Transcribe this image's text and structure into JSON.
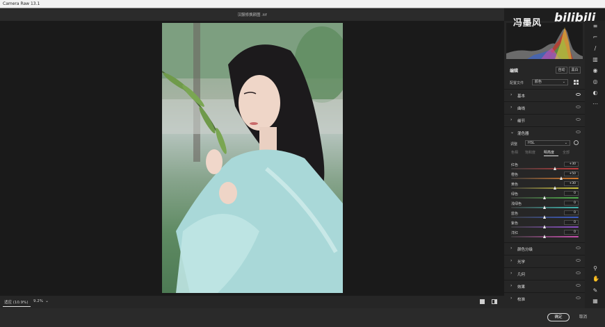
{
  "window": {
    "title": "Camera Raw 13.1"
  },
  "document": {
    "filename": "汉服修换颜图 .tif"
  },
  "watermark": {
    "text": "冯墨风",
    "logo": "bilibili"
  },
  "bottom_bar": {
    "zoom_label": "适应 (10.9%)",
    "zoom_percent": "9.2%"
  },
  "footer": {
    "ok_label": "确定",
    "cancel_label": "取消"
  },
  "panel": {
    "edit_title": "编辑",
    "auto_label": "自动",
    "bw_label": "黑白",
    "profile_label": "配置文件",
    "profile_value": "颜色",
    "sections_top": [
      {
        "label": "基本",
        "eye": "on"
      },
      {
        "label": "曲线",
        "eye": "off"
      },
      {
        "label": "细节",
        "eye": "off"
      }
    ],
    "mixer": {
      "title": "混色器",
      "adjust_label": "调整",
      "adjust_value": "HSL",
      "tabs": [
        "色相",
        "饱和度",
        "明亮度",
        "全部"
      ],
      "active_tab": "明亮度",
      "sliders": [
        {
          "name": "红色",
          "value": "+30",
          "level": 0.65,
          "track": "linear-gradient(90deg,#3a3a3a,#c23b3b)"
        },
        {
          "name": "橙色",
          "value": "+50",
          "level": 0.75,
          "track": "linear-gradient(90deg,#3a3a3a,#d77a2c)"
        },
        {
          "name": "黄色",
          "value": "+30",
          "level": 0.65,
          "track": "linear-gradient(90deg,#3a3a3a,#cfc43a)"
        },
        {
          "name": "绿色",
          "value": "0",
          "level": 0.5,
          "track": "linear-gradient(90deg,#3a3a3a,#4fb24a)"
        },
        {
          "name": "浅绿色",
          "value": "0",
          "level": 0.5,
          "track": "linear-gradient(90deg,#3a3a3a,#3fb7b0)"
        },
        {
          "name": "蓝色",
          "value": "0",
          "level": 0.5,
          "track": "linear-gradient(90deg,#3a3a3a,#3b5cc9)"
        },
        {
          "name": "紫色",
          "value": "0",
          "level": 0.5,
          "track": "linear-gradient(90deg,#3a3a3a,#8d4fc9)"
        },
        {
          "name": "洋红",
          "value": "0",
          "level": 0.5,
          "track": "linear-gradient(90deg,#3a3a3a,#c94fae)"
        }
      ]
    },
    "sections_bottom": [
      {
        "label": "颜色分级"
      },
      {
        "label": "光学"
      },
      {
        "label": "几何"
      },
      {
        "label": "效果"
      },
      {
        "label": "校准"
      }
    ]
  }
}
